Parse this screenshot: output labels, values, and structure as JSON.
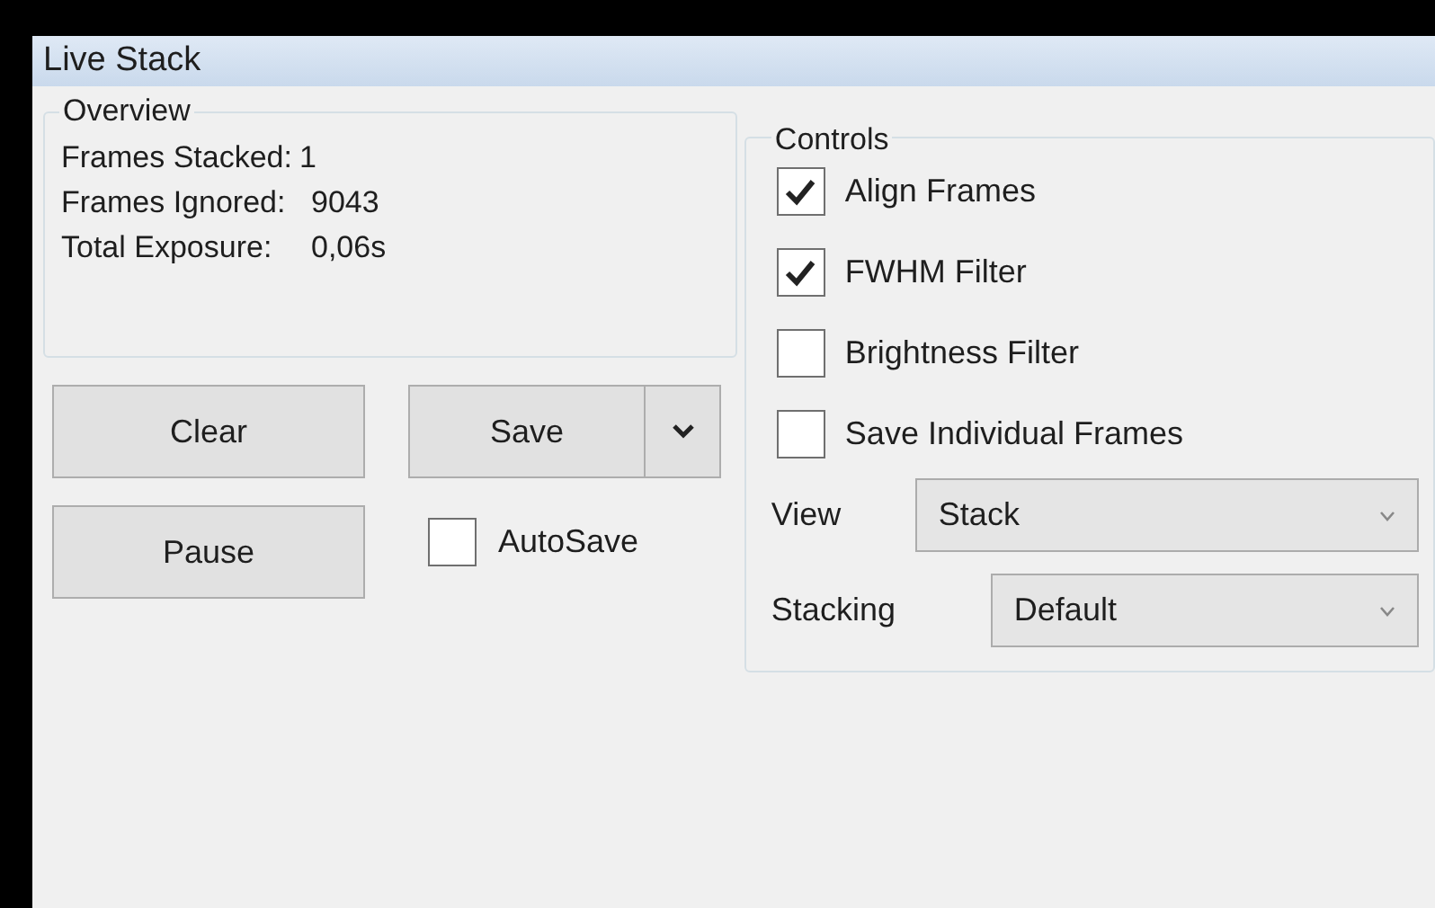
{
  "window": {
    "title": "Live Stack"
  },
  "overview": {
    "title": "Overview",
    "rows": [
      {
        "label": "Frames Stacked:",
        "value": "1"
      },
      {
        "label": "Frames Ignored:",
        "value": "9043"
      },
      {
        "label": "Total Exposure:",
        "value": "0,06s"
      }
    ]
  },
  "buttons": {
    "clear": "Clear",
    "save": "Save",
    "pause": "Pause"
  },
  "autosave": {
    "label": "AutoSave",
    "checked": false
  },
  "controls": {
    "title": "Controls",
    "checkboxes": [
      {
        "label": "Align Frames",
        "checked": true
      },
      {
        "label": "FWHM Filter",
        "checked": true
      },
      {
        "label": "Brightness Filter",
        "checked": false
      },
      {
        "label": "Save Individual Frames",
        "checked": false
      }
    ],
    "selects": [
      {
        "label": "View",
        "value": "Stack"
      },
      {
        "label": "Stacking",
        "value": "Default"
      }
    ]
  }
}
